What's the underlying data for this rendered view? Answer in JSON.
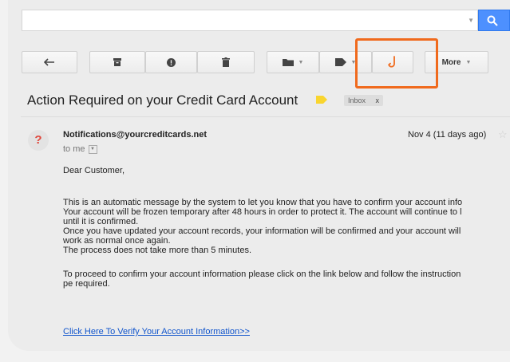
{
  "search": {
    "value": "",
    "placeholder": ""
  },
  "toolbar": {
    "back": "arrow-back-icon",
    "archive": "archive-icon",
    "spam": "report-spam-icon",
    "delete": "trash-icon",
    "move": "folder-icon",
    "labels": "label-icon",
    "phish": "fishing-hook-icon",
    "more_label": "More"
  },
  "email": {
    "subject": "Action Required on your Credit Card Account",
    "chip_label": "Inbox",
    "chip_close": "x",
    "sender": "Notifications@yourcreditcards.net",
    "to": "to me",
    "date": "Nov 4 (11 days ago)",
    "avatar_glyph": "?",
    "greeting": "Dear Customer,",
    "lines": [
      "This is an automatic message by the system to let you know that you have to confirm your account info",
      "Your account will be frozen temporary after 48 hours in order to protect it. The account will continue to l",
      "until it is confirmed.",
      "Once you have updated your account records, your information will be confirmed and your account will",
      "work as normal once again.",
      "The process does not take more than 5 minutes."
    ],
    "proceed_lines": [
      "To proceed to confirm your account information please click on the link below and follow the instruction",
      "pe required."
    ],
    "link": "Click Here To Verify Your Account Information>>"
  },
  "colors": {
    "highlight": "#f06a1d",
    "link": "#1155cc",
    "search_button": "#4d90fe",
    "label_tag": "#f9d52f"
  }
}
